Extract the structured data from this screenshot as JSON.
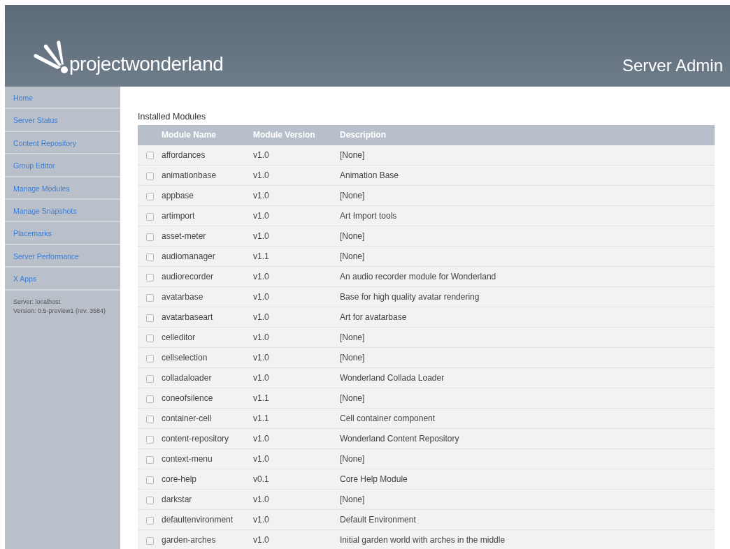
{
  "header": {
    "logo_text": "projectwonderland",
    "title": "Server Admin"
  },
  "sidebar": {
    "items": [
      {
        "label": "Home"
      },
      {
        "label": "Server Status"
      },
      {
        "label": "Content Repository"
      },
      {
        "label": "Group Editor"
      },
      {
        "label": "Manage Modules"
      },
      {
        "label": "Manage Snapshots"
      },
      {
        "label": "Placemarks"
      },
      {
        "label": "Server Performance"
      },
      {
        "label": "X Apps"
      }
    ],
    "info": [
      "Server: localhost",
      "Version: 0.5-preview1 (rev. 3584)"
    ]
  },
  "section_title": "Installed Modules",
  "table": {
    "columns": [
      "Module Name",
      "Module Version",
      "Description"
    ],
    "rows": [
      {
        "checked": false,
        "name": "affordances",
        "version": "v1.0",
        "description": "[None]"
      },
      {
        "checked": false,
        "name": "animationbase",
        "version": "v1.0",
        "description": "Animation Base"
      },
      {
        "checked": false,
        "name": "appbase",
        "version": "v1.0",
        "description": "[None]"
      },
      {
        "checked": false,
        "name": "artimport",
        "version": "v1.0",
        "description": "Art Import tools"
      },
      {
        "checked": false,
        "name": "asset-meter",
        "version": "v1.0",
        "description": "[None]"
      },
      {
        "checked": false,
        "name": "audiomanager",
        "version": "v1.1",
        "description": "[None]"
      },
      {
        "checked": false,
        "name": "audiorecorder",
        "version": "v1.0",
        "description": "An audio recorder module for Wonderland"
      },
      {
        "checked": false,
        "name": "avatarbase",
        "version": "v1.0",
        "description": "Base for high quality avatar rendering"
      },
      {
        "checked": false,
        "name": "avatarbaseart",
        "version": "v1.0",
        "description": "Art for avatarbase"
      },
      {
        "checked": false,
        "name": "celleditor",
        "version": "v1.0",
        "description": "[None]"
      },
      {
        "checked": false,
        "name": "cellselection",
        "version": "v1.0",
        "description": "[None]"
      },
      {
        "checked": false,
        "name": "colladaloader",
        "version": "v1.0",
        "description": "Wonderland Collada Loader"
      },
      {
        "checked": false,
        "name": "coneofsilence",
        "version": "v1.1",
        "description": "[None]"
      },
      {
        "checked": false,
        "name": "container-cell",
        "version": "v1.1",
        "description": "Cell container component"
      },
      {
        "checked": false,
        "name": "content-repository",
        "version": "v1.0",
        "description": "Wonderland Content Repository"
      },
      {
        "checked": false,
        "name": "context-menu",
        "version": "v1.0",
        "description": "[None]"
      },
      {
        "checked": false,
        "name": "core-help",
        "version": "v0.1",
        "description": "Core Help Module"
      },
      {
        "checked": false,
        "name": "darkstar",
        "version": "v1.0",
        "description": "[None]"
      },
      {
        "checked": false,
        "name": "defaultenvironment",
        "version": "v1.0",
        "description": "Default Environment"
      },
      {
        "checked": false,
        "name": "garden-arches",
        "version": "v1.0",
        "description": "Initial garden world with arches in the middle"
      }
    ]
  }
}
